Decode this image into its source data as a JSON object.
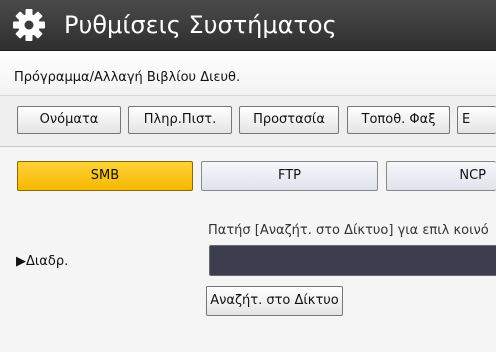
{
  "window": {
    "title": "Ρυθμίσεις Συστήματος",
    "icon": "gear-icon"
  },
  "breadcrumb": {
    "text": "Πρόγραμμα/Αλλαγή Βιβλίου Διευθ."
  },
  "tabs": [
    {
      "label": "Ονόματα"
    },
    {
      "label": "Πληρ.Πιστ."
    },
    {
      "label": "Προστασία"
    },
    {
      "label": "Τοποθ. Φαξ"
    },
    {
      "label": "E"
    }
  ],
  "protocols": {
    "selected": "SMB",
    "items": [
      {
        "label": "SMB"
      },
      {
        "label": "FTP"
      },
      {
        "label": "NCP"
      }
    ]
  },
  "path": {
    "hint": "Πατήσ [Αναζήτ. στο Δίκτυο] για επιλ κοινό",
    "label": "▶Διαδρ.",
    "value": "",
    "browse_label": "Αναζήτ. στο Δίκτυο"
  },
  "colors": {
    "titlebar": "#3a3a3a",
    "selected": "#f5b800",
    "input": "#3c3d4e"
  }
}
